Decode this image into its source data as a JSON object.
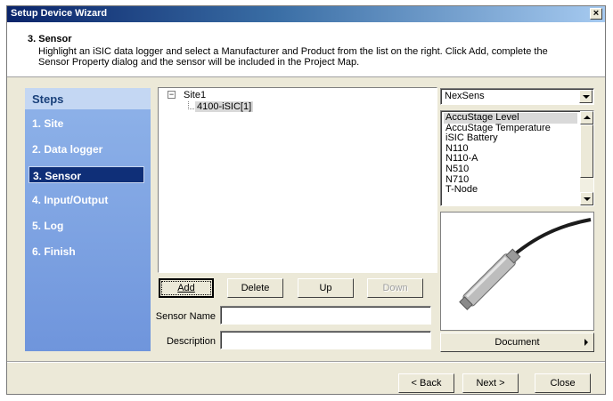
{
  "window": {
    "title": "Setup Device Wizard",
    "close_label": "×"
  },
  "header": {
    "title": "3. Sensor",
    "description": "Highlight an iSIC data logger and select a Manufacturer and Product from the list on the right. Click Add, complete the Sensor Property dialog and the sensor will be included in the Project Map."
  },
  "steps": {
    "heading": "Steps",
    "items": [
      {
        "label": "1. Site"
      },
      {
        "label": "2. Data logger"
      },
      {
        "label": "3. Sensor",
        "active": true
      },
      {
        "label": "4. Input/Output"
      },
      {
        "label": "5. Log"
      },
      {
        "label": "6. Finish"
      }
    ]
  },
  "tree": {
    "root": "Site1",
    "expander": "−",
    "child": "4100-iSIC[1]"
  },
  "buttons": {
    "add": "Add",
    "delete": "Delete",
    "up": "Up",
    "down": "Down",
    "document": "Document",
    "back": "< Back",
    "next": "Next >",
    "close": "Close"
  },
  "fields": {
    "sensor_name_label": "Sensor Name",
    "sensor_name_value": "",
    "description_label": "Description",
    "description_value": ""
  },
  "manufacturer": {
    "selected": "NexSens"
  },
  "products": {
    "items": [
      "AccuStage Level",
      "AccuStage Temperature",
      "iSIC Battery",
      "N110",
      "N110-A",
      "N510",
      "N710",
      "T-Node"
    ],
    "selected_index": 0
  },
  "colors": {
    "title_bar_start": "#0a246a",
    "steps_panel": "#7a9fe0",
    "active_step": "#0f2f78",
    "dialog_bg": "#ece9d8"
  }
}
